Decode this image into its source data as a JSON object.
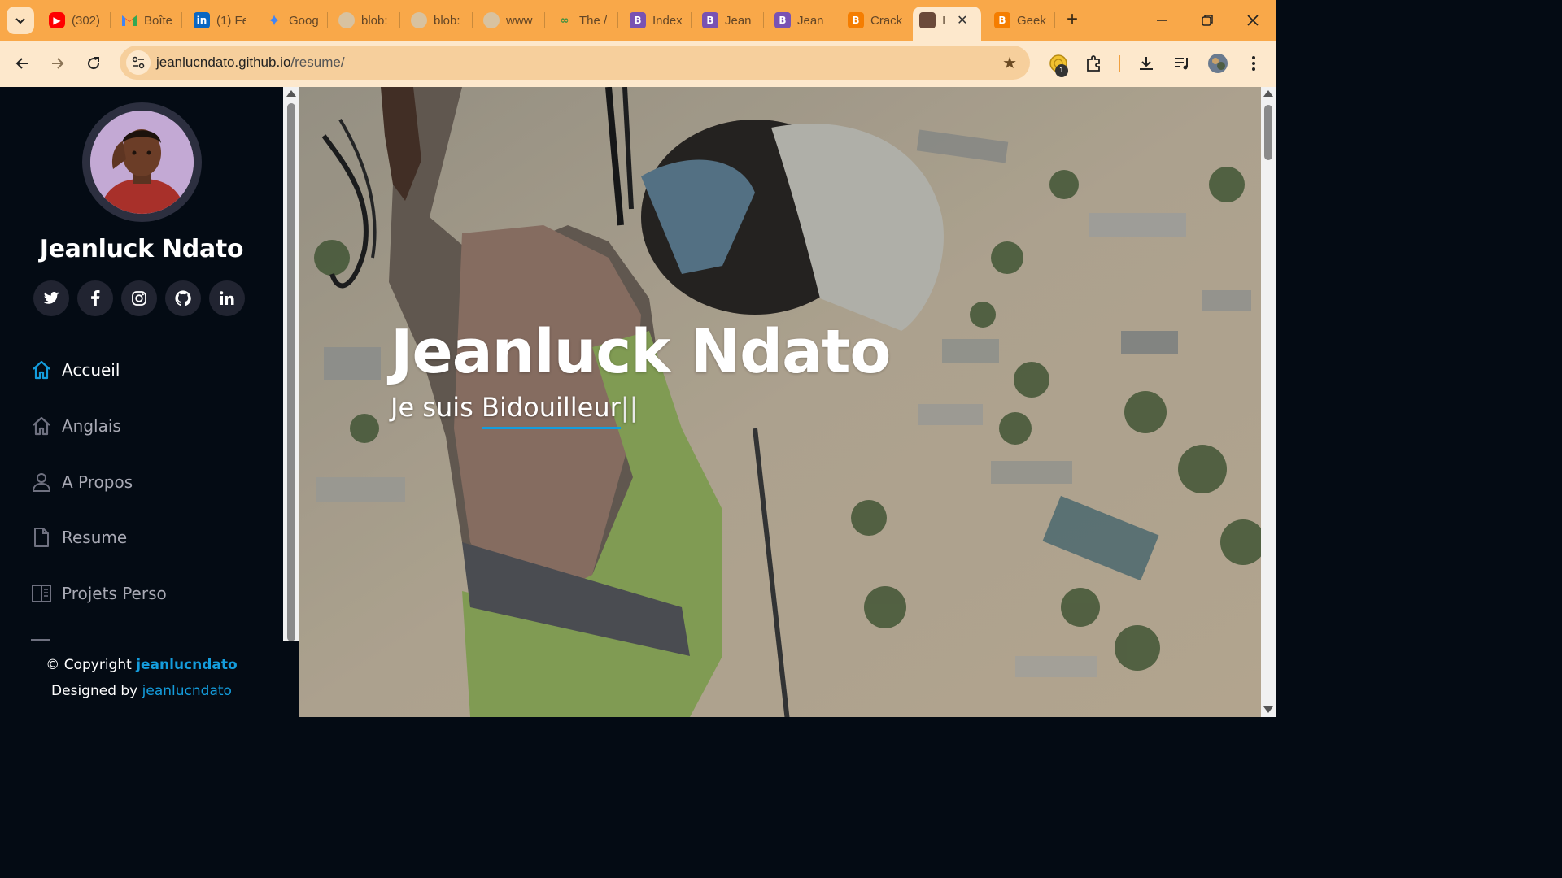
{
  "browser": {
    "tabs": [
      {
        "label": "(302)",
        "icon": "youtube-icon",
        "color": "#ff0000"
      },
      {
        "label": "Boîte",
        "icon": "gmail-icon",
        "color": "#ea4335"
      },
      {
        "label": "(1) Fe",
        "icon": "linkedin-icon",
        "color": "#0a66c2"
      },
      {
        "label": "Goog",
        "icon": "gemini-icon",
        "color": "#4285f4"
      },
      {
        "label": "blob:",
        "icon": "globe-icon",
        "color": "#9e9e9e"
      },
      {
        "label": "blob:",
        "icon": "globe-icon",
        "color": "#9e9e9e"
      },
      {
        "label": "www",
        "icon": "globe-icon",
        "color": "#9e9e9e"
      },
      {
        "label": "The /",
        "icon": "site-icon",
        "color": "#4caf50"
      },
      {
        "label": "Index",
        "icon": "bootstrap-icon",
        "color": "#7952b3"
      },
      {
        "label": "Jean",
        "icon": "bootstrap-icon",
        "color": "#7952b3"
      },
      {
        "label": "Jean",
        "icon": "bootstrap-icon",
        "color": "#7952b3"
      },
      {
        "label": "Crack",
        "icon": "blogger-icon",
        "color": "#f57d00"
      },
      {
        "label": "I",
        "icon": "profile-photo-icon",
        "color": "#6b4a3a",
        "active": true
      },
      {
        "label": "Geek",
        "icon": "blogger-icon",
        "color": "#f57d00"
      }
    ],
    "url_host": "jeanlucndato.github.io",
    "url_path": "/resume/",
    "extension_badge": "1"
  },
  "profile": {
    "name": "Jeanluck Ndato",
    "socials": [
      "twitter-icon",
      "facebook-icon",
      "instagram-icon",
      "github-icon",
      "linkedin-icon"
    ]
  },
  "nav": {
    "items": [
      {
        "label": "Accueil",
        "icon": "home-icon",
        "active": true
      },
      {
        "label": "Anglais",
        "icon": "home-icon"
      },
      {
        "label": "A Propos",
        "icon": "person-icon"
      },
      {
        "label": "Resume",
        "icon": "file-icon"
      },
      {
        "label": "Projets Perso",
        "icon": "book-icon"
      }
    ]
  },
  "footer": {
    "copyright_prefix": "© Copyright",
    "copyright_brand": "jeanlucndato",
    "designed_prefix": "Designed by",
    "designed_brand": "jeanlucndato"
  },
  "hero": {
    "title": "Jeanluck Ndato",
    "subtitle_prefix": "Je suis ",
    "subtitle_typed": "Bidouilleur",
    "caret": "||"
  },
  "colors": {
    "accent": "#149ddd",
    "sidebar_bg": "#040b14",
    "chrome": "#f9a849"
  }
}
